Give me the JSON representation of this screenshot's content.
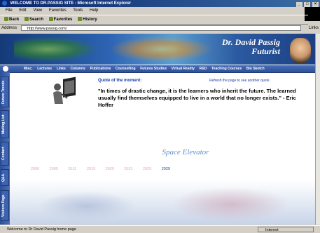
{
  "window": {
    "title": "WELCOME TO DR.PASSIG SITE - Microsoft Internet Explorer",
    "controls": [
      "_",
      "□",
      "×"
    ]
  },
  "menu": [
    "File",
    "Edit",
    "View",
    "Favorites",
    "Tools",
    "Help"
  ],
  "toolbar": {
    "back": "Back",
    "search": "Search",
    "favorites": "Favorites",
    "history": "History"
  },
  "address": {
    "label": "Address",
    "url": "http://www.passig.com/",
    "links": "Links"
  },
  "banner": {
    "name_line1": "Dr. David Passig",
    "name_line2": "Futurist"
  },
  "nav": [
    "Misc.",
    "Lectures",
    "Links",
    "Columns",
    "Publications",
    "Counselling",
    "Futures Studies",
    "Virtual Reality",
    "R&D",
    "Teaching Courses",
    "Bio Sketch"
  ],
  "side_tabs": [
    "Future Trends",
    "Mailing List",
    "Contact",
    "Q&A",
    "Visitors Page"
  ],
  "quote": {
    "title": "Quote of the moment:",
    "refresh": "Refresh the page to see another quote",
    "text": "\"In times of drastic change, it is the learners who inherit the future. The learned usually find themselves equipped to live in a world that no longer exists.\" - Eric Hoffer"
  },
  "feature": "Space Elevator",
  "years": [
    "2000",
    "2005",
    "2011",
    "2015",
    "2020",
    "2021",
    "2025",
    "2029"
  ],
  "status": {
    "text": "Welcome to Dr David Passig home page",
    "zone": "Internet"
  }
}
